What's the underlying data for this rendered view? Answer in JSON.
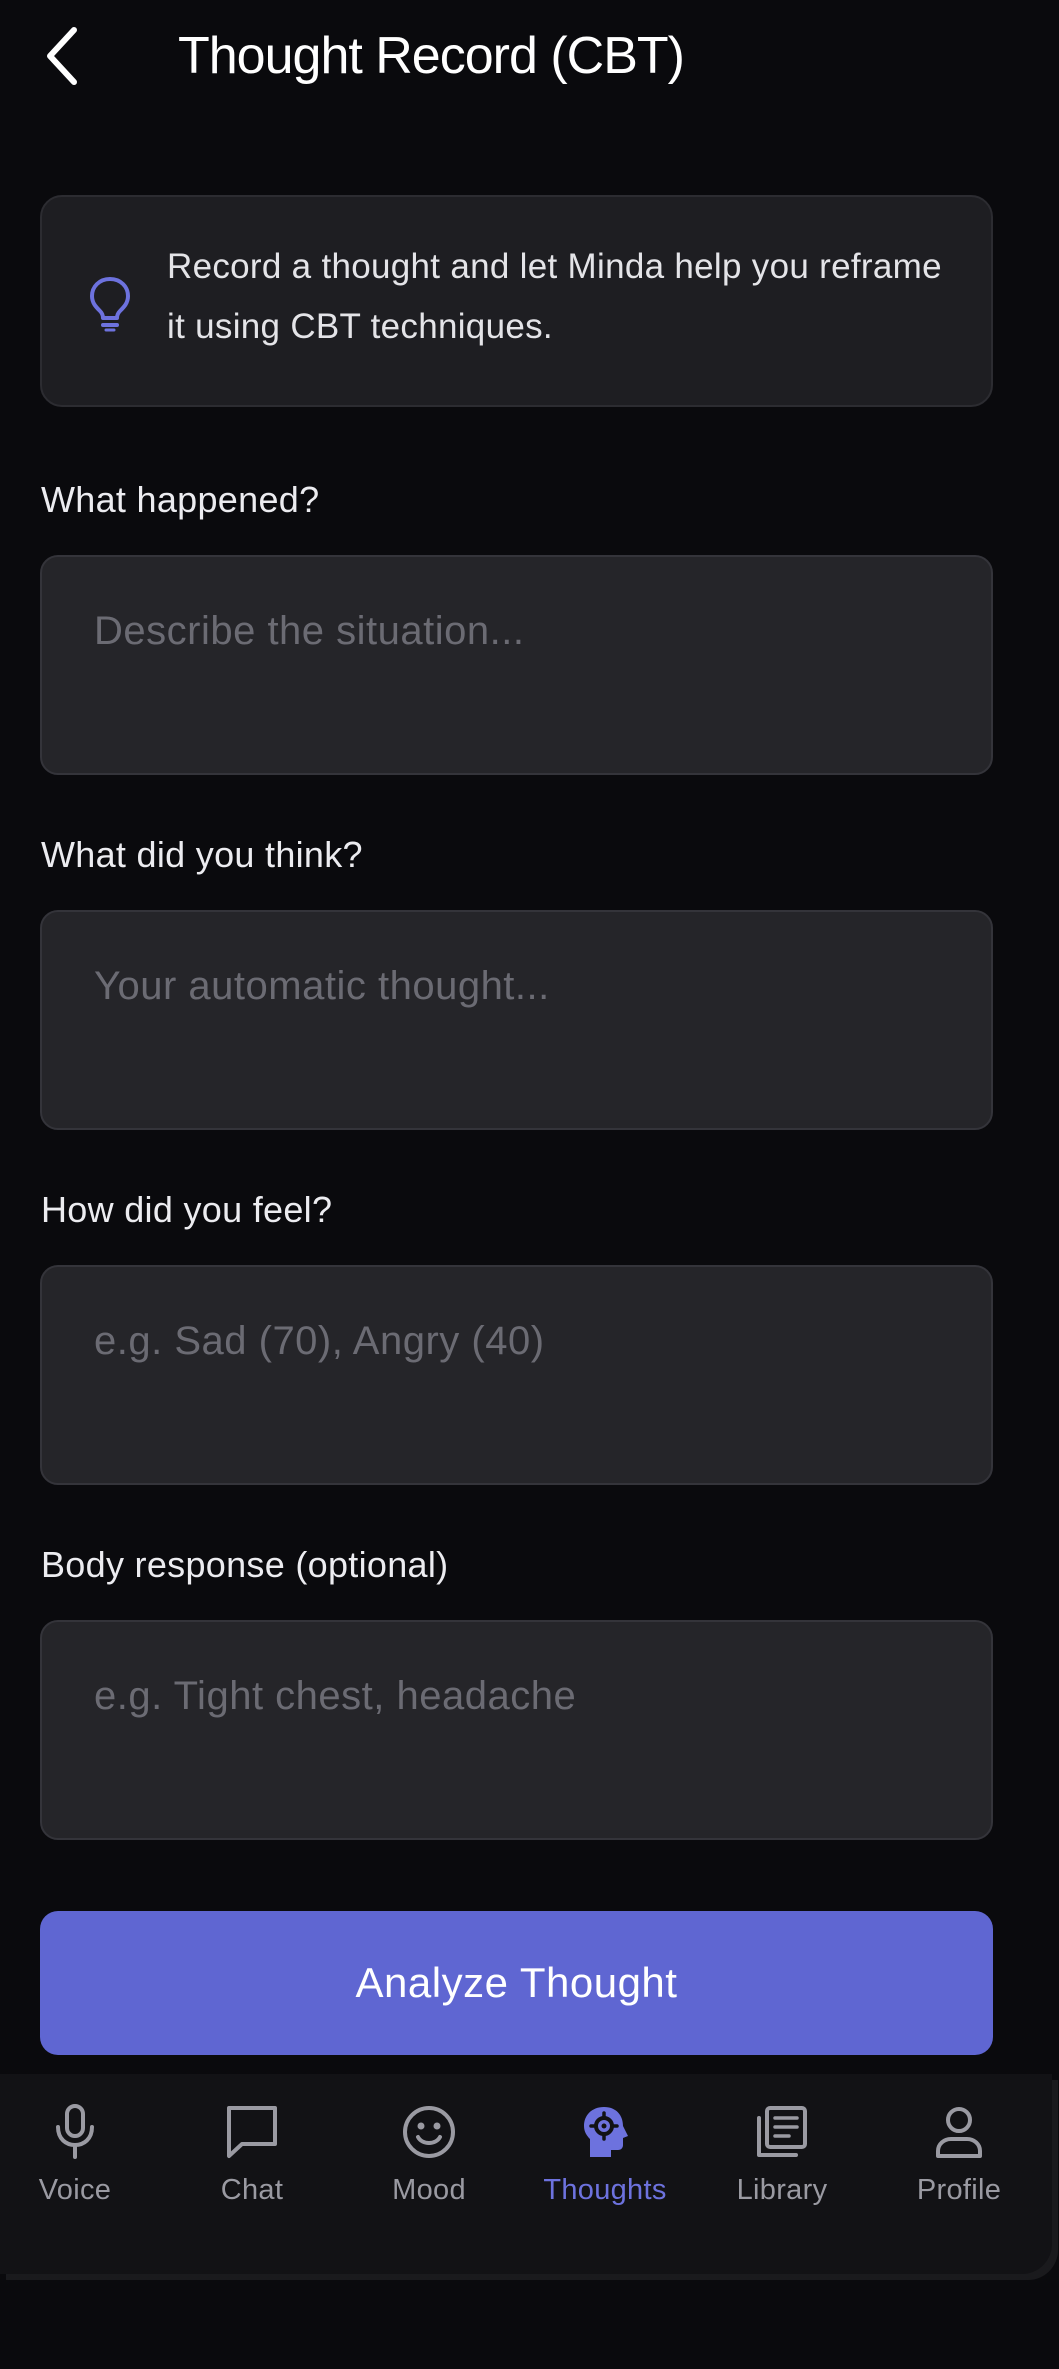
{
  "header": {
    "title": "Thought Record (CBT)",
    "back_icon": "chevron-left-icon"
  },
  "info": {
    "icon": "lightbulb-icon",
    "text": "Record a thought and let Minda help you reframe it using CBT techniques."
  },
  "fields": [
    {
      "label": "What happened?",
      "placeholder": "Describe the situation...",
      "value": ""
    },
    {
      "label": "What did you think?",
      "placeholder": "Your automatic thought...",
      "value": ""
    },
    {
      "label": "How did you feel?",
      "placeholder": "e.g. Sad (70), Angry (40)",
      "value": ""
    },
    {
      "label": "Body response (optional)",
      "placeholder": "e.g. Tight chest, headache",
      "value": ""
    }
  ],
  "analyze_label": "Analyze Thought",
  "tabs": [
    {
      "label": "Voice",
      "icon": "microphone-icon",
      "active": false
    },
    {
      "label": "Chat",
      "icon": "chat-bubble-icon",
      "active": false
    },
    {
      "label": "Mood",
      "icon": "smiley-icon",
      "active": false
    },
    {
      "label": "Thoughts",
      "icon": "head-gear-icon",
      "active": true
    },
    {
      "label": "Library",
      "icon": "library-icon",
      "active": false
    },
    {
      "label": "Profile",
      "icon": "person-icon",
      "active": false
    }
  ],
  "colors": {
    "accent": "#5f66d2",
    "active_tab": "#6d72de",
    "background": "#0a0a0d",
    "card": "#1e1e22",
    "input": "#252529"
  }
}
